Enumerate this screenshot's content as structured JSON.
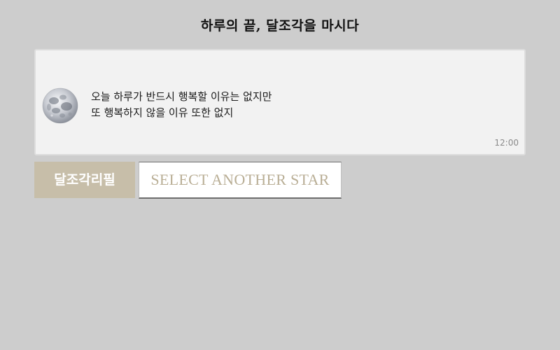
{
  "header": {
    "title": "하루의 끝, 달조각을 마시다"
  },
  "message": {
    "avatar_icon": "moon-icon",
    "lines": [
      "오늘 하루가 반드시 행복할 이유는 없지만",
      "또 행복하지 않을 이유 또한 없지"
    ],
    "time": "12:00"
  },
  "actions": {
    "label": "달조각리필",
    "select_button_label": "SELECT ANOTHER STAR"
  },
  "colors": {
    "page_background": "#cdcdcd",
    "card_background": "#f2f2f2",
    "label_background": "#c7bea9",
    "button_text": "#b9ae95"
  }
}
